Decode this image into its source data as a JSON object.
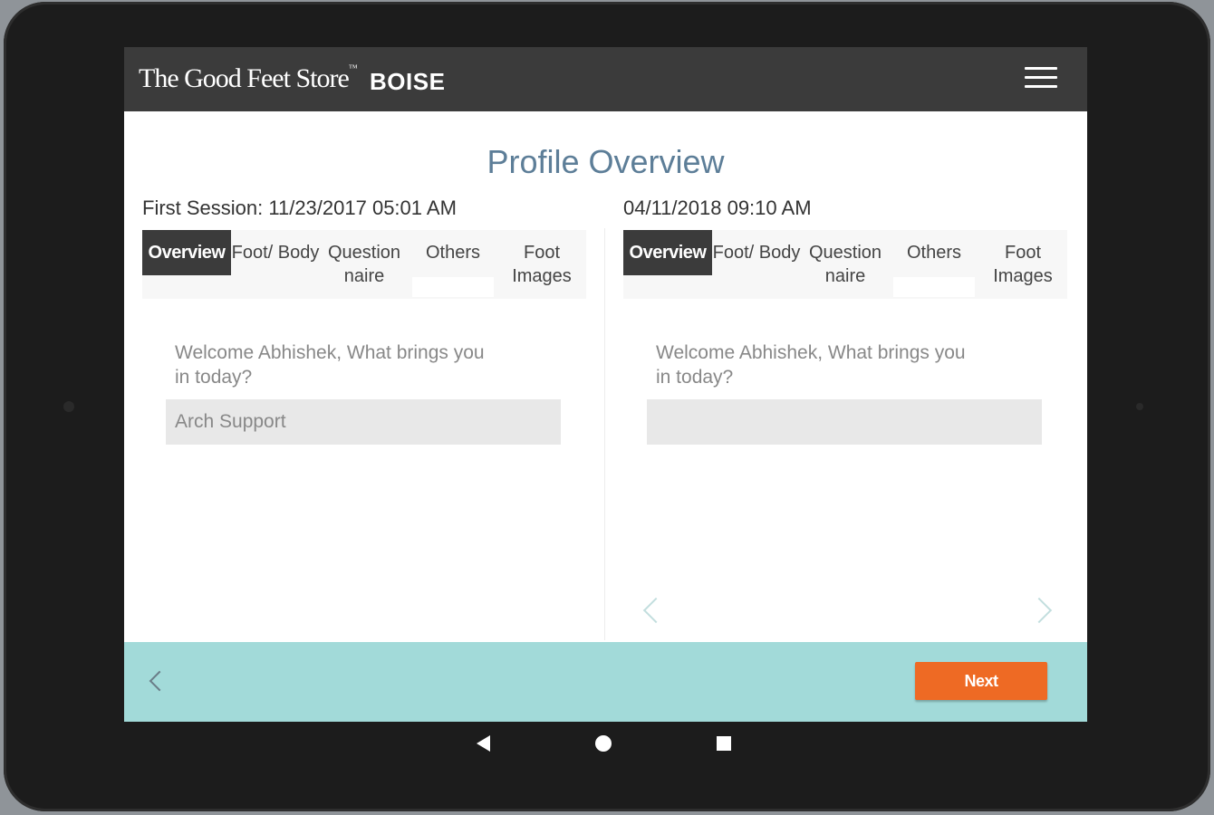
{
  "appbar": {
    "brand": "The Good Feet Store",
    "brand_mark": "™",
    "store": "BOISE",
    "menu_icon": "hamburger-menu-icon"
  },
  "page_title": "Profile Overview",
  "sessions": [
    {
      "label": "First Session: 11/23/2017 05:01 AM",
      "tabs": {
        "overview": "Overview",
        "foot_body": "Foot/ Body",
        "questionnaire": "Question naire",
        "others": "Others",
        "foot_images": "Foot Images"
      },
      "question": "Welcome Abhishek, What brings you in today?",
      "answer": "Arch Support"
    },
    {
      "label": "04/11/2018 09:10 AM",
      "tabs": {
        "overview": "Overview",
        "foot_body": "Foot/ Body",
        "questionnaire": "Question naire",
        "others": "Others",
        "foot_images": "Foot Images"
      },
      "question": "Welcome Abhishek, What brings you in today?",
      "answer": ""
    }
  ],
  "footer": {
    "next_label": "Next"
  },
  "colors": {
    "appbar": "#3b3b3b",
    "title": "#5d7e98",
    "footer": "#a2dad9",
    "next_button": "#ee6a24"
  }
}
